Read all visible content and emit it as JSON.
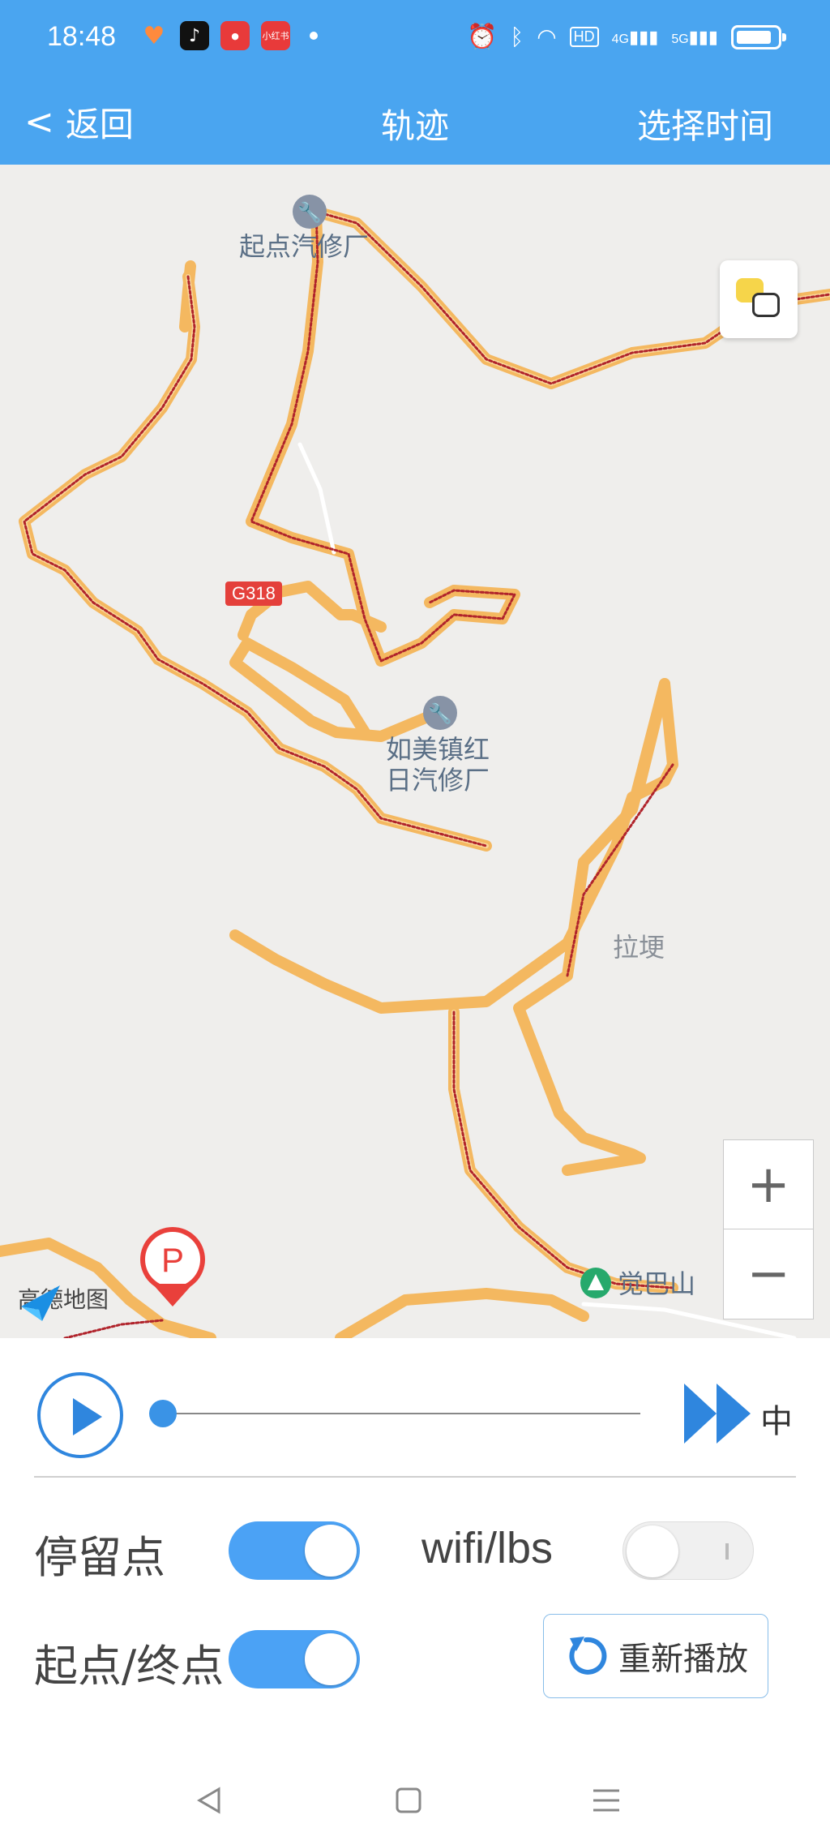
{
  "status_bar": {
    "time": "18:48",
    "app_icon_texts": [
      "",
      "",
      "",
      "小红书"
    ],
    "network": [
      "HD",
      "4G",
      "5G"
    ]
  },
  "header": {
    "back_label": "返回",
    "title": "轨迹",
    "action_label": "选择时间"
  },
  "map": {
    "poi": [
      {
        "name": "起点汽修厂"
      },
      {
        "name": "如美镇红日汽修厂"
      },
      {
        "name": "拉埂"
      },
      {
        "name": "觉巴山"
      }
    ],
    "road_badge": "G318",
    "zoom_in": "+",
    "zoom_out": "−",
    "provider": "高德地图",
    "parking_label": "P"
  },
  "playback": {
    "speed_label": "中",
    "progress": 0
  },
  "options": {
    "stop_points": {
      "label": "停留点",
      "enabled": true
    },
    "wifi_lbs": {
      "label": "wifi/lbs",
      "enabled": false
    },
    "start_end": {
      "label": "起点/终点",
      "enabled": true
    },
    "replay_label": "重新播放"
  },
  "colors": {
    "accent": "#4aa5f0",
    "route": "#f4b860",
    "track": "#b0232b"
  }
}
